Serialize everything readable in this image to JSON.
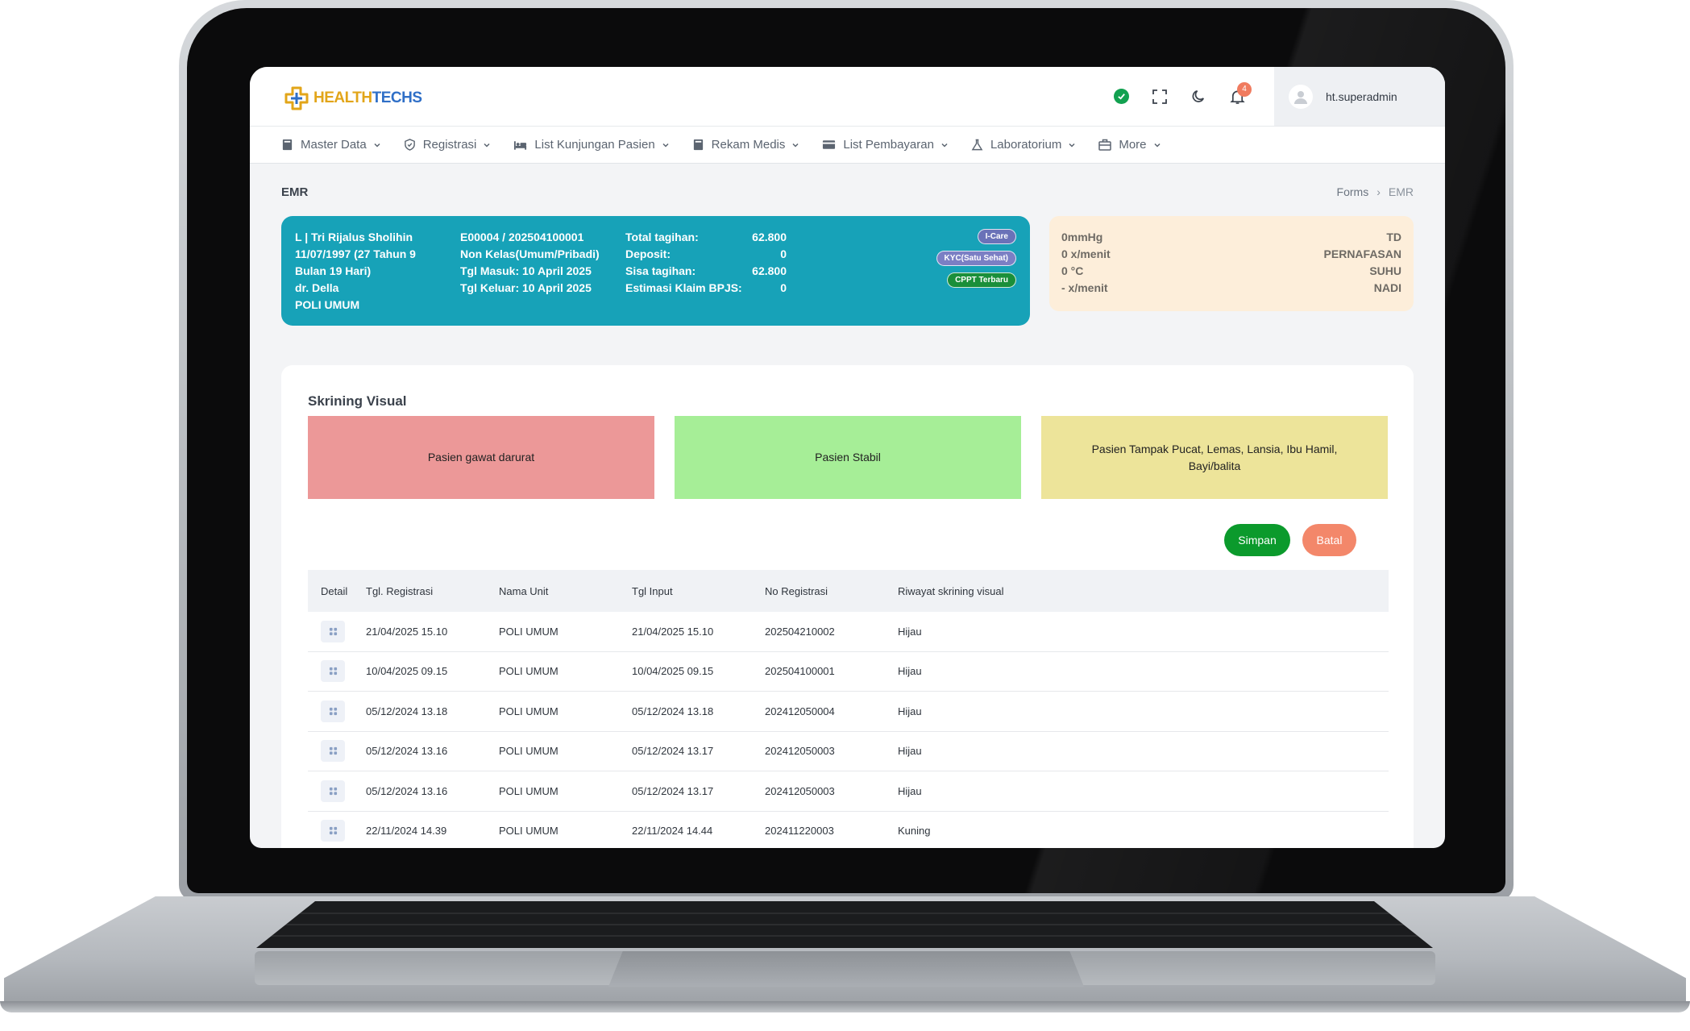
{
  "brand": {
    "part1": "HEALTH",
    "part2": "TECHS"
  },
  "topbar": {
    "notification_count": "4",
    "username": "ht.superadmin"
  },
  "nav": [
    {
      "label": "Master Data",
      "icon": "book-icon"
    },
    {
      "label": "Registrasi",
      "icon": "shield-icon"
    },
    {
      "label": "List Kunjungan Pasien",
      "icon": "bed-icon"
    },
    {
      "label": "Rekam Medis",
      "icon": "book-icon"
    },
    {
      "label": "List Pembayaran",
      "icon": "card-icon"
    },
    {
      "label": "Laboratorium",
      "icon": "flask-icon"
    },
    {
      "label": "More",
      "icon": "briefcase-icon"
    }
  ],
  "page": {
    "title": "EMR",
    "breadcrumb": [
      "Forms",
      "EMR"
    ]
  },
  "patient": {
    "line1": "L | Tri Rijalus Sholihin",
    "dob": "11/07/1997 (27 Tahun 9 Bulan 19 Hari)",
    "doctor": "dr. Della",
    "unit": "POLI UMUM",
    "reg_no": "E00004 / 202504100001",
    "class": "Non Kelas(Umum/Pribadi)",
    "tgl_masuk": "Tgl Masuk: 10 April 2025",
    "tgl_keluar": "Tgl Keluar: 10 April 2025",
    "billing": [
      {
        "label": "Total tagihan:",
        "value": "62.800"
      },
      {
        "label": "Deposit:",
        "value": "0"
      },
      {
        "label": "Sisa tagihan:",
        "value": "62.800"
      },
      {
        "label": "Estimasi Klaim BPJS:",
        "value": "0"
      }
    ],
    "badges": [
      "I-Care",
      "KYC(Satu Sehat)",
      "CPPT Terbaru"
    ]
  },
  "vitals": [
    {
      "value": "0mmHg",
      "label": "TD"
    },
    {
      "value": "0 x/menit",
      "label": "PERNAFASAN"
    },
    {
      "value": "0 °C",
      "label": "SUHU"
    },
    {
      "value": "- x/menit",
      "label": "NADI"
    }
  ],
  "screening": {
    "title": "Skrining Visual",
    "options": [
      "Pasien gawat darurat",
      "Pasien Stabil",
      "Pasien Tampak Pucat, Lemas, Lansia, Ibu Hamil, Bayi/balita"
    ],
    "colors": {
      "red": "#ec9898",
      "green": "#a6ee97",
      "yellow": "#ede49a"
    },
    "save_label": "Simpan",
    "cancel_label": "Batal"
  },
  "table": {
    "headers": [
      "Detail",
      "Tgl. Registrasi",
      "Nama Unit",
      "Tgl Input",
      "No Registrasi",
      "Riwayat skrining visual"
    ],
    "rows": [
      [
        "21/04/2025 15.10",
        "POLI UMUM",
        "21/04/2025 15.10",
        "202504210002",
        "Hijau"
      ],
      [
        "10/04/2025 09.15",
        "POLI UMUM",
        "10/04/2025 09.15",
        "202504100001",
        "Hijau"
      ],
      [
        "05/12/2024 13.18",
        "POLI UMUM",
        "05/12/2024 13.18",
        "202412050004",
        "Hijau"
      ],
      [
        "05/12/2024 13.16",
        "POLI UMUM",
        "05/12/2024 13.17",
        "202412050003",
        "Hijau"
      ],
      [
        "05/12/2024 13.16",
        "POLI UMUM",
        "05/12/2024 13.17",
        "202412050003",
        "Hijau"
      ],
      [
        "22/11/2024 14.39",
        "POLI UMUM",
        "22/11/2024 14.44",
        "202411220003",
        "Kuning"
      ]
    ]
  }
}
